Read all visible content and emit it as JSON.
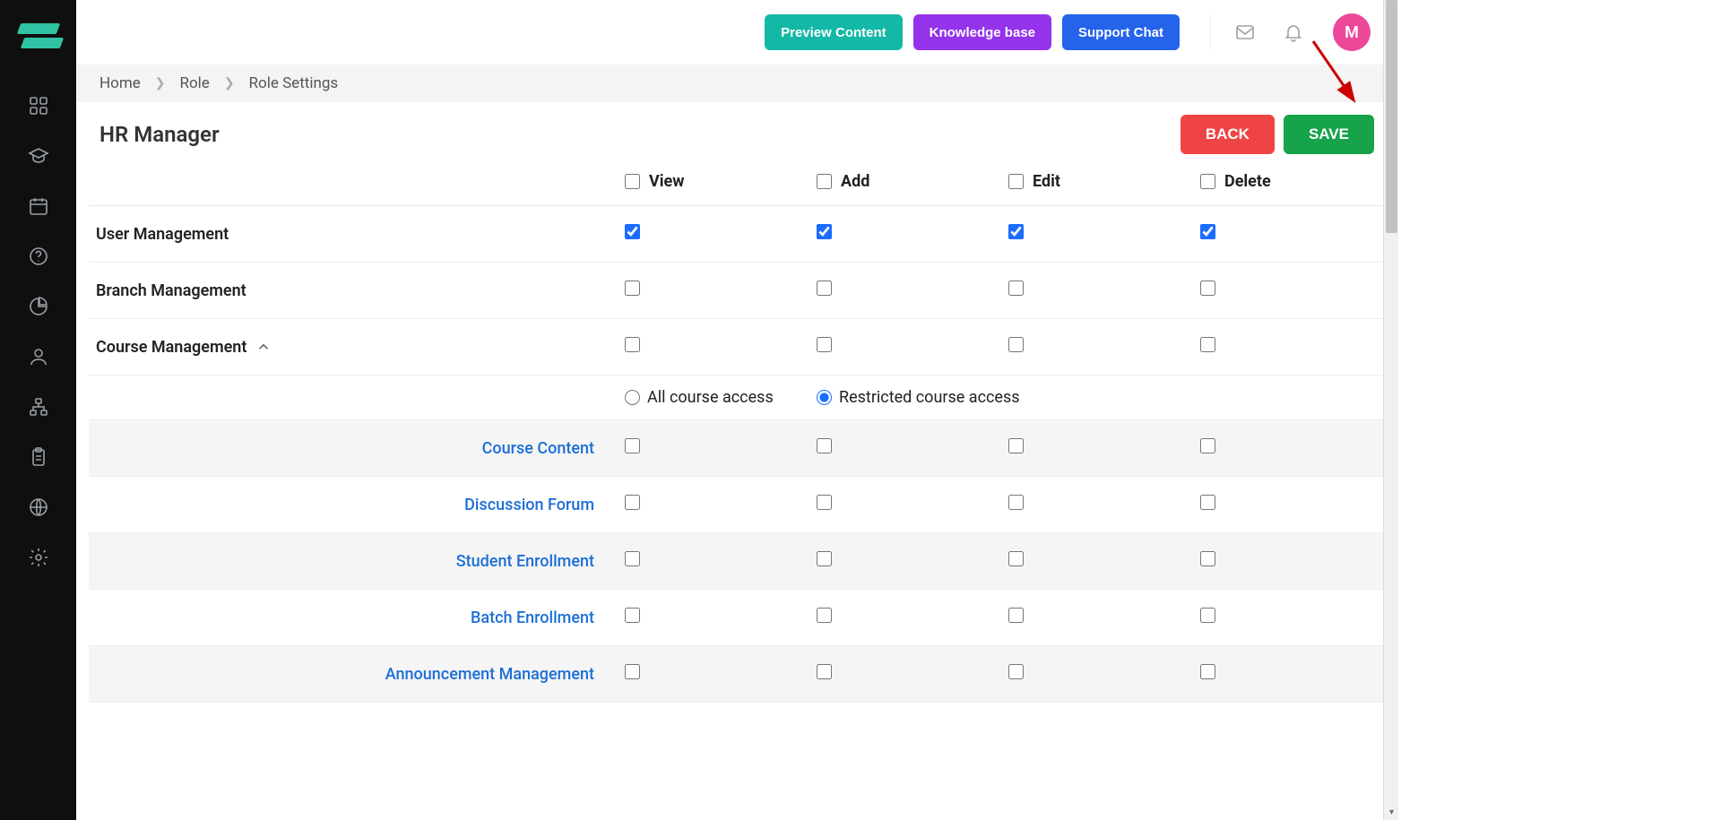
{
  "avatar_initial": "M",
  "topbar": {
    "preview": "Preview Content",
    "kb": "Knowledge base",
    "support": "Support Chat"
  },
  "breadcrumb": {
    "home": "Home",
    "role": "Role",
    "settings": "Role Settings"
  },
  "page_title": "HR Manager",
  "buttons": {
    "back": "BACK",
    "save": "SAVE"
  },
  "columns": {
    "view": "View",
    "add": "Add",
    "edit": "Edit",
    "delete": "Delete"
  },
  "rows": {
    "user_mgmt": "User Management",
    "branch_mgmt": "Branch Management",
    "course_mgmt": "Course Management"
  },
  "radio": {
    "all": "All course access",
    "restricted": "Restricted course access"
  },
  "subs": {
    "course_content": "Course Content",
    "discussion": "Discussion Forum",
    "student_enroll": "Student Enrollment",
    "batch_enroll": "Batch Enrollment",
    "announcement": "Announcement Management"
  },
  "permissions": {
    "user_mgmt": {
      "view": true,
      "add": true,
      "edit": true,
      "delete": true
    },
    "branch_mgmt": {
      "view": false,
      "add": false,
      "edit": false,
      "delete": false
    },
    "course_mgmt": {
      "view": false,
      "add": false,
      "edit": false,
      "delete": false
    },
    "course_access_mode": "restricted",
    "course_content": {
      "view": false,
      "add": false,
      "edit": false,
      "delete": false
    },
    "discussion": {
      "view": false,
      "add": false,
      "edit": false,
      "delete": false
    },
    "student_enroll": {
      "view": false,
      "add": false,
      "edit": false,
      "delete": false
    },
    "batch_enroll": {
      "view": false,
      "add": false,
      "edit": false,
      "delete": false
    },
    "announcement": {
      "view": false,
      "add": false,
      "edit": false,
      "delete": false
    }
  }
}
